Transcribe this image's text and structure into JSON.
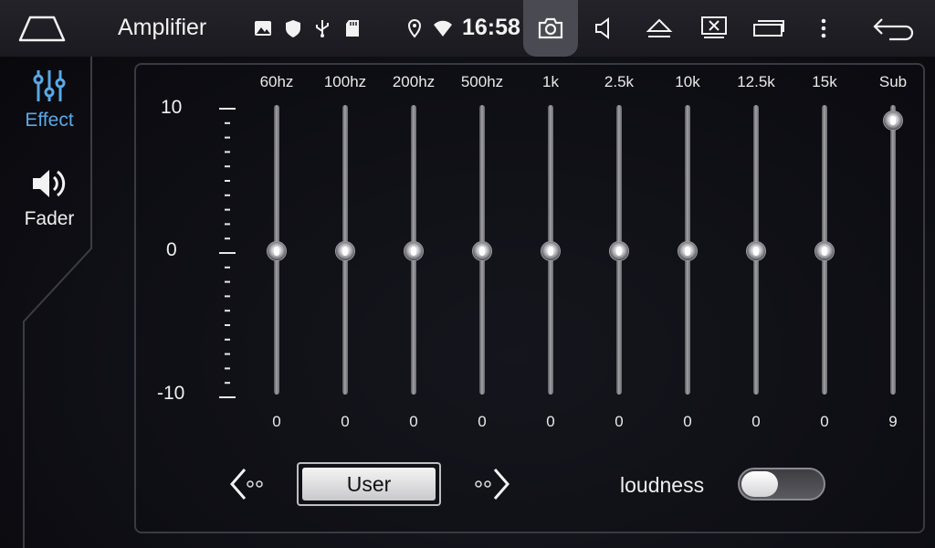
{
  "statusbar": {
    "app_title": "Amplifier",
    "clock": "16:58",
    "icons": [
      "home-icon",
      "image-icon",
      "shield-icon",
      "usb-icon",
      "sd-card-icon",
      "location-icon",
      "wifi-icon",
      "camera-icon",
      "volume-icon",
      "eject-icon",
      "screen-off-icon",
      "window-icon",
      "more-icon",
      "back-icon"
    ]
  },
  "sidebar": {
    "items": [
      {
        "label": "Effect",
        "icon": "equalizer-icon",
        "active": true
      },
      {
        "label": "Fader",
        "icon": "speaker-icon",
        "active": false
      }
    ]
  },
  "eq": {
    "scale_max": "10",
    "scale_mid": "0",
    "scale_min": "-10",
    "bands": [
      {
        "label": "60hz",
        "value": "0"
      },
      {
        "label": "100hz",
        "value": "0"
      },
      {
        "label": "200hz",
        "value": "0"
      },
      {
        "label": "500hz",
        "value": "0"
      },
      {
        "label": "1k",
        "value": "0"
      },
      {
        "label": "2.5k",
        "value": "0"
      },
      {
        "label": "10k",
        "value": "0"
      },
      {
        "label": "12.5k",
        "value": "0"
      },
      {
        "label": "15k",
        "value": "0"
      },
      {
        "label": "Sub",
        "value": "9"
      }
    ],
    "preset": "User",
    "loudness_label": "loudness",
    "loudness_on": false
  },
  "colors": {
    "accent": "#5aa9e6",
    "background": "#101017"
  }
}
